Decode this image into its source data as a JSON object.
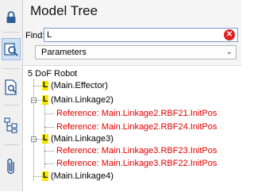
{
  "panel": {
    "title": "Model Tree"
  },
  "find": {
    "label": "Find:",
    "value": "L"
  },
  "filter": {
    "selected": "Parameters"
  },
  "tree": {
    "root": "5 DoF Robot",
    "effector": "(Main.Effector)",
    "linkage2": "(Main.Linkage2)",
    "linkage2_refs": [
      "Reference: Main.Linkage2.RBF21.InitPos",
      "Reference: Main.Linkage2.RBF24.InitPos"
    ],
    "linkage3": "(Main.Linkage3)",
    "linkage3_refs": [
      "Reference: Main.Linkage3.RBF23.InitPos",
      "Reference: Main.Linkage3.RBF22.InitPos"
    ],
    "linkage4": "(Main.Linkage4)",
    "node_icon": "L"
  },
  "colors": {
    "reference_text": "#e00000",
    "node_icon_bg": "#f7e600",
    "active_tool_bg": "#cfe0f3"
  },
  "icons": [
    "lock-icon",
    "model-tree-search-icon",
    "document-search-icon",
    "hierarchy-icon",
    "paperclip-icon",
    "clear-icon",
    "chevron-down-icon"
  ]
}
